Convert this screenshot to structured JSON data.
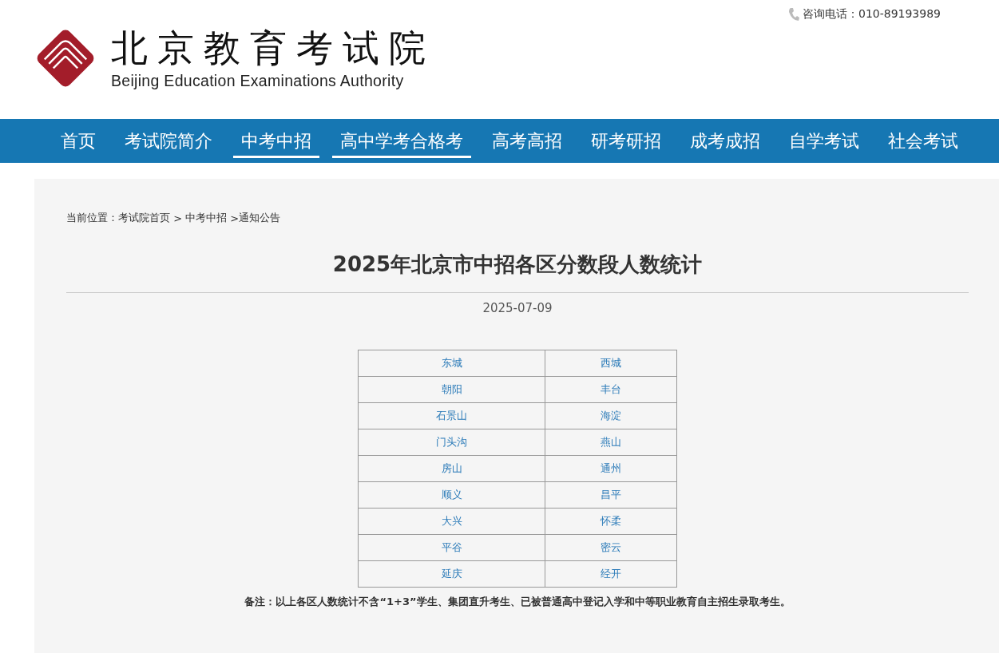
{
  "header": {
    "logo_title": "北京教育考试院",
    "logo_subtitle": "Beijing Education Examinations Authority",
    "phone": "咨询电话：010-89193989"
  },
  "nav": [
    {
      "label": "首页",
      "selected": false
    },
    {
      "label": "考试院简介",
      "selected": false
    },
    {
      "label": "中考中招",
      "selected": true
    },
    {
      "label": "高中学考合格考",
      "selected": true
    },
    {
      "label": "高考高招",
      "selected": false
    },
    {
      "label": "研考研招",
      "selected": false
    },
    {
      "label": "成考成招",
      "selected": false
    },
    {
      "label": "自学考试",
      "selected": false
    },
    {
      "label": "社会考试",
      "selected": false
    }
  ],
  "breadcrumb": {
    "label": "当前位置：",
    "items": [
      "考试院首页",
      "中考中招",
      "通知公告"
    ],
    "separators": [
      " > ",
      " >"
    ]
  },
  "article": {
    "title": "2025年北京市中招各区分数段人数统计",
    "date": "2025-07-09",
    "table_rows": [
      [
        "东城",
        "西城"
      ],
      [
        "朝阳",
        "丰台"
      ],
      [
        "石景山",
        "海淀"
      ],
      [
        "门头沟",
        "燕山"
      ],
      [
        "房山",
        "通州"
      ],
      [
        "顺义",
        "昌平"
      ],
      [
        "大兴",
        "怀柔"
      ],
      [
        "平谷",
        "密云"
      ],
      [
        "延庆",
        "经开"
      ]
    ],
    "note": "备注：以上各区人数统计不含“1+3”学生、集团直升考生、已被普通高中登记入学和中等职业教育自主招生录取考生。"
  }
}
